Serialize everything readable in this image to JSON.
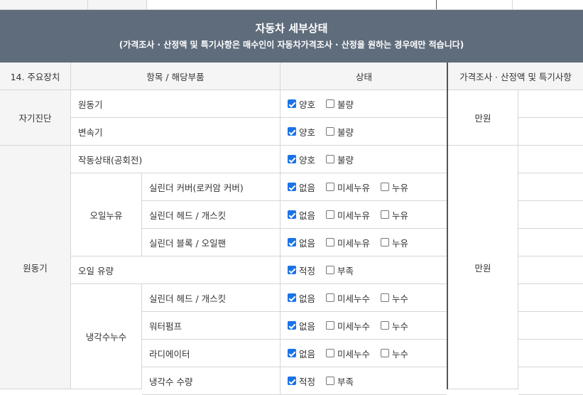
{
  "header": {
    "title": "자동차 세부상태",
    "subtitle": "(가격조사 · 산정액 및 특기사항은 매수인이 자동차가격조사 · 산정을 원하는 경우에만 적습니다)"
  },
  "columns": {
    "section": "14. 주요장치",
    "item": "항목 / 해당부품",
    "status": "상태",
    "price": "가격조사 · 산정액 및 특기사항"
  },
  "groups": {
    "selfdiag": "자기진단",
    "engine": "원동기",
    "oilleak": "오일누유",
    "coolant": "냉각수누수"
  },
  "price_unit": "만원",
  "rows": [
    {
      "label": "원동기",
      "options": [
        {
          "text": "양호",
          "checked": true
        },
        {
          "text": "불량",
          "checked": false
        }
      ]
    },
    {
      "label": "변속기",
      "options": [
        {
          "text": "양호",
          "checked": true
        },
        {
          "text": "불량",
          "checked": false
        }
      ]
    },
    {
      "label": "작동상태(공회전)",
      "options": [
        {
          "text": "양호",
          "checked": true
        },
        {
          "text": "불량",
          "checked": false
        }
      ]
    },
    {
      "label": "실린더 커버(로커암 커버)",
      "options": [
        {
          "text": "없음",
          "checked": true
        },
        {
          "text": "미세누유",
          "checked": false
        },
        {
          "text": "누유",
          "checked": false
        }
      ]
    },
    {
      "label": "실린더 헤드 / 개스킷",
      "options": [
        {
          "text": "없음",
          "checked": true
        },
        {
          "text": "미세누유",
          "checked": false
        },
        {
          "text": "누유",
          "checked": false
        }
      ]
    },
    {
      "label": "실린더 블록 / 오일팬",
      "options": [
        {
          "text": "없음",
          "checked": true
        },
        {
          "text": "미세누유",
          "checked": false
        },
        {
          "text": "누유",
          "checked": false
        }
      ]
    },
    {
      "label": "오일 유량",
      "options": [
        {
          "text": "적정",
          "checked": true
        },
        {
          "text": "부족",
          "checked": false
        }
      ]
    },
    {
      "label": "실린더 헤드 / 개스킷",
      "options": [
        {
          "text": "없음",
          "checked": true
        },
        {
          "text": "미세누수",
          "checked": false
        },
        {
          "text": "누수",
          "checked": false
        }
      ]
    },
    {
      "label": "워터펌프",
      "options": [
        {
          "text": "없음",
          "checked": true
        },
        {
          "text": "미세누수",
          "checked": false
        },
        {
          "text": "누수",
          "checked": false
        }
      ]
    },
    {
      "label": "라디에이터",
      "options": [
        {
          "text": "없음",
          "checked": true
        },
        {
          "text": "미세누수",
          "checked": false
        },
        {
          "text": "누수",
          "checked": false
        }
      ]
    },
    {
      "label": "냉각수 수량",
      "options": [
        {
          "text": "적정",
          "checked": true
        },
        {
          "text": "부족",
          "checked": false
        }
      ]
    }
  ]
}
